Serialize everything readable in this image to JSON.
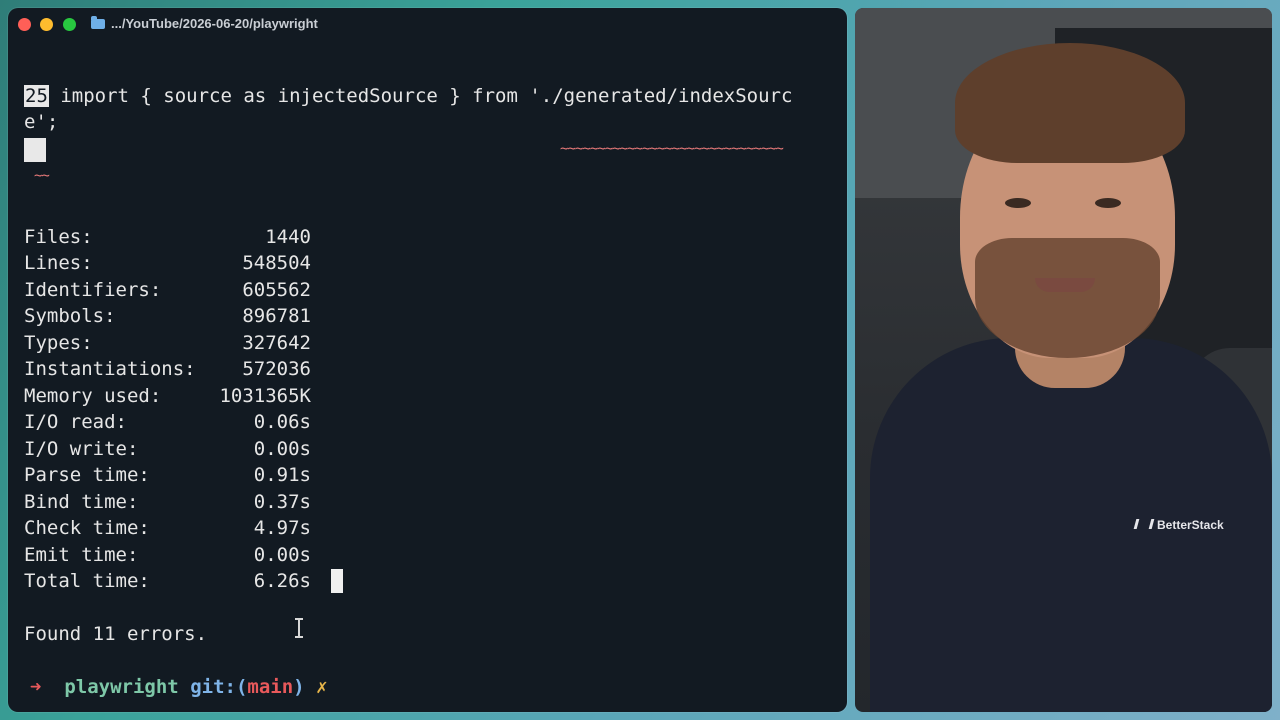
{
  "window": {
    "title": ".../YouTube/2026-06-20/playwright"
  },
  "editor_line": {
    "line_number": "25",
    "code": " import { source as injectedSource } from './generated/indexSourc",
    "code_wrap": "e';",
    "squiggle": "~~~~~~~~~~~~~~~~~~~~~~~~~~~~~~",
    "squiggle_wrap": "~~"
  },
  "stats": [
    {
      "label": "Files:",
      "value": "1440"
    },
    {
      "label": "Lines:",
      "value": "548504"
    },
    {
      "label": "Identifiers:",
      "value": "605562"
    },
    {
      "label": "Symbols:",
      "value": "896781"
    },
    {
      "label": "Types:",
      "value": "327642"
    },
    {
      "label": "Instantiations:",
      "value": "572036"
    },
    {
      "label": "Memory used:",
      "value": "1031365K"
    },
    {
      "label": "I/O read:",
      "value": "0.06s"
    },
    {
      "label": "I/O write:",
      "value": "0.00s"
    },
    {
      "label": "Parse time:",
      "value": "0.91s"
    },
    {
      "label": "Bind time:",
      "value": "0.37s"
    },
    {
      "label": "Check time:",
      "value": "4.97s"
    },
    {
      "label": "Emit time:",
      "value": "0.00s"
    },
    {
      "label": "Total time:",
      "value": "6.26s"
    }
  ],
  "summary": "Found 11 errors.",
  "prompt": {
    "arrow": "➜",
    "dir": "playwright",
    "git": "git:(",
    "branch": "main",
    "git_close": ")",
    "dirty": "✗"
  },
  "webcam": {
    "shirt_logo": "BetterStack"
  },
  "colors": {
    "terminal_bg": "#121a22",
    "error_squiggle": "#e87a7a",
    "prompt_arrow": "#e8595b",
    "prompt_dir": "#7ec8a8"
  }
}
